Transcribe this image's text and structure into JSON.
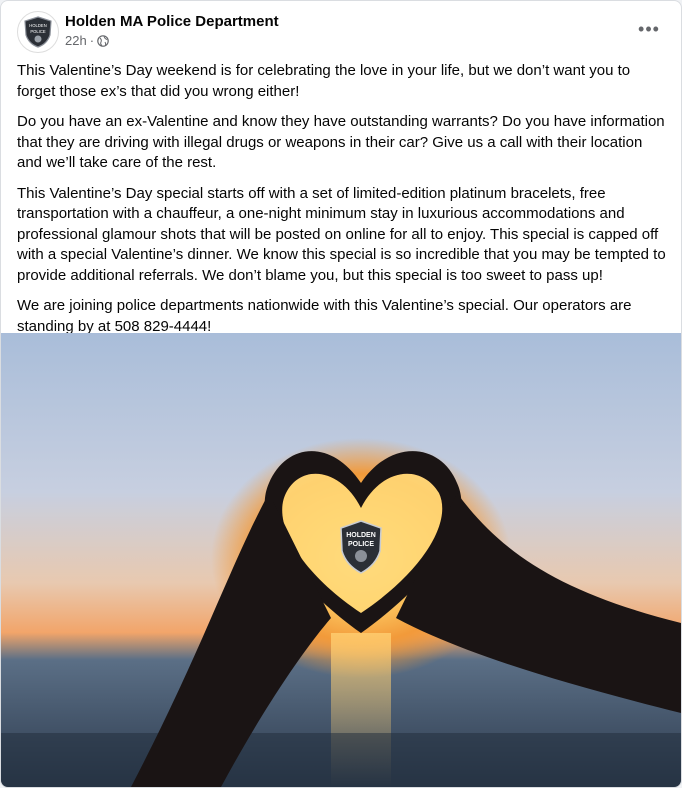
{
  "post": {
    "page_name": "Holden MA Police Department",
    "time": "22h",
    "dot": "·",
    "privacy_icon": "globe-icon",
    "more_icon": "more-options-icon",
    "more_label": "•••",
    "avatar_icon": "police-badge-icon",
    "paragraphs": [
      "This Valentine’s Day weekend is for celebrating the love in your life, but we don’t want you to forget those ex’s that did you wrong either!",
      "Do you have an ex-Valentine and know they have outstanding warrants? Do you have information that they are driving with illegal drugs or weapons in their car? Give us a call with their location and we’ll take care of the rest.",
      "This Valentine’s Day special starts off with a set of limited-edition platinum bracelets, free transportation with a chauffeur, a one-night minimum stay in luxurious accommodations and professional glamour shots that will be posted on online for all to enjoy. This special is capped off with a special Valentine’s dinner. We know this special is so incredible that you may be tempted to provide additional referrals. We don’t blame you, but this special is too sweet to pass up!",
      "We are joining police departments nationwide with this Valentine’s special. Our operators are standing by at 508 829-4444!"
    ]
  },
  "photo": {
    "badge_lines": [
      "HOLDEN",
      "POLICE"
    ],
    "colors": {
      "sky_top": "#aebfd8",
      "sun": "#ffd36a",
      "sea": "#33485f",
      "hands": "#1a1414"
    }
  }
}
